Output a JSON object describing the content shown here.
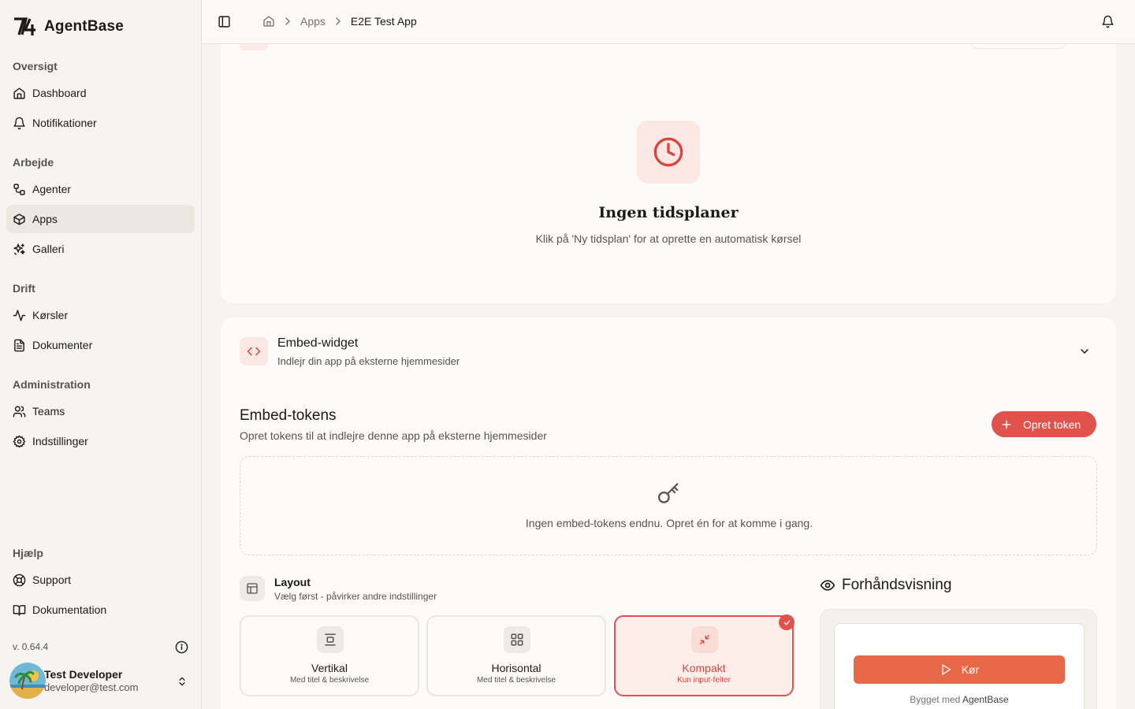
{
  "brand": {
    "name": "AgentBase"
  },
  "sidebar": {
    "sections": [
      {
        "label": "Oversigt"
      },
      {
        "label": "Arbejde"
      },
      {
        "label": "Drift"
      },
      {
        "label": "Administration"
      },
      {
        "label": "Hjælp"
      }
    ],
    "items": [
      {
        "label": "Dashboard",
        "icon": "home-icon"
      },
      {
        "label": "Notifikationer",
        "icon": "bell-icon"
      },
      {
        "label": "Agenter",
        "icon": "workflow-icon"
      },
      {
        "label": "Apps",
        "icon": "box-icon",
        "active": true
      },
      {
        "label": "Galleri",
        "icon": "sparkles-icon"
      },
      {
        "label": "Kørsler",
        "icon": "activity-icon"
      },
      {
        "label": "Dokumenter",
        "icon": "document-icon"
      },
      {
        "label": "Teams",
        "icon": "users-icon"
      },
      {
        "label": "Indstillinger",
        "icon": "gear-icon"
      },
      {
        "label": "Support",
        "icon": "lifebuoy-icon"
      },
      {
        "label": "Dokumentation",
        "icon": "book-icon"
      }
    ],
    "version": "v. 0.64.4",
    "user": {
      "name": "Test Developer",
      "email": "developer@test.com"
    }
  },
  "header": {
    "breadcrumb": [
      "Apps",
      "E2E Test App"
    ]
  },
  "schedules": {
    "empty_title": "Ingen tidsplaner",
    "empty_sub": "Klik på 'Ny tidsplan' for at oprette en automatisk kørsel"
  },
  "embed": {
    "title": "Embed-widget",
    "subtitle": "Indlejr din app på eksterne hjemmesider",
    "tokens_title": "Embed-tokens",
    "tokens_sub": "Opret tokens til at indlejre denne app på eksterne hjemmesider",
    "create_token_label": "Opret token",
    "empty_tokens": "Ingen embed-tokens endnu. Opret én for at komme i gang."
  },
  "layout": {
    "title": "Layout",
    "subtitle": "Vælg først - påvirker andre indstillinger",
    "options": [
      {
        "title": "Vertikal",
        "sub": "Med titel & beskrivelse"
      },
      {
        "title": "Horisontal",
        "sub": "Med titel & beskrivelse"
      },
      {
        "title": "Kompakt",
        "sub": "Kun input-felter",
        "selected": true
      }
    ]
  },
  "preview": {
    "title": "Forhåndsvisning",
    "run_label": "Kør",
    "built_prefix": "Bygget med",
    "built_brand": "AgentBase"
  },
  "colors": {
    "accent": "#e0524c",
    "run_button": "#e8684a"
  }
}
